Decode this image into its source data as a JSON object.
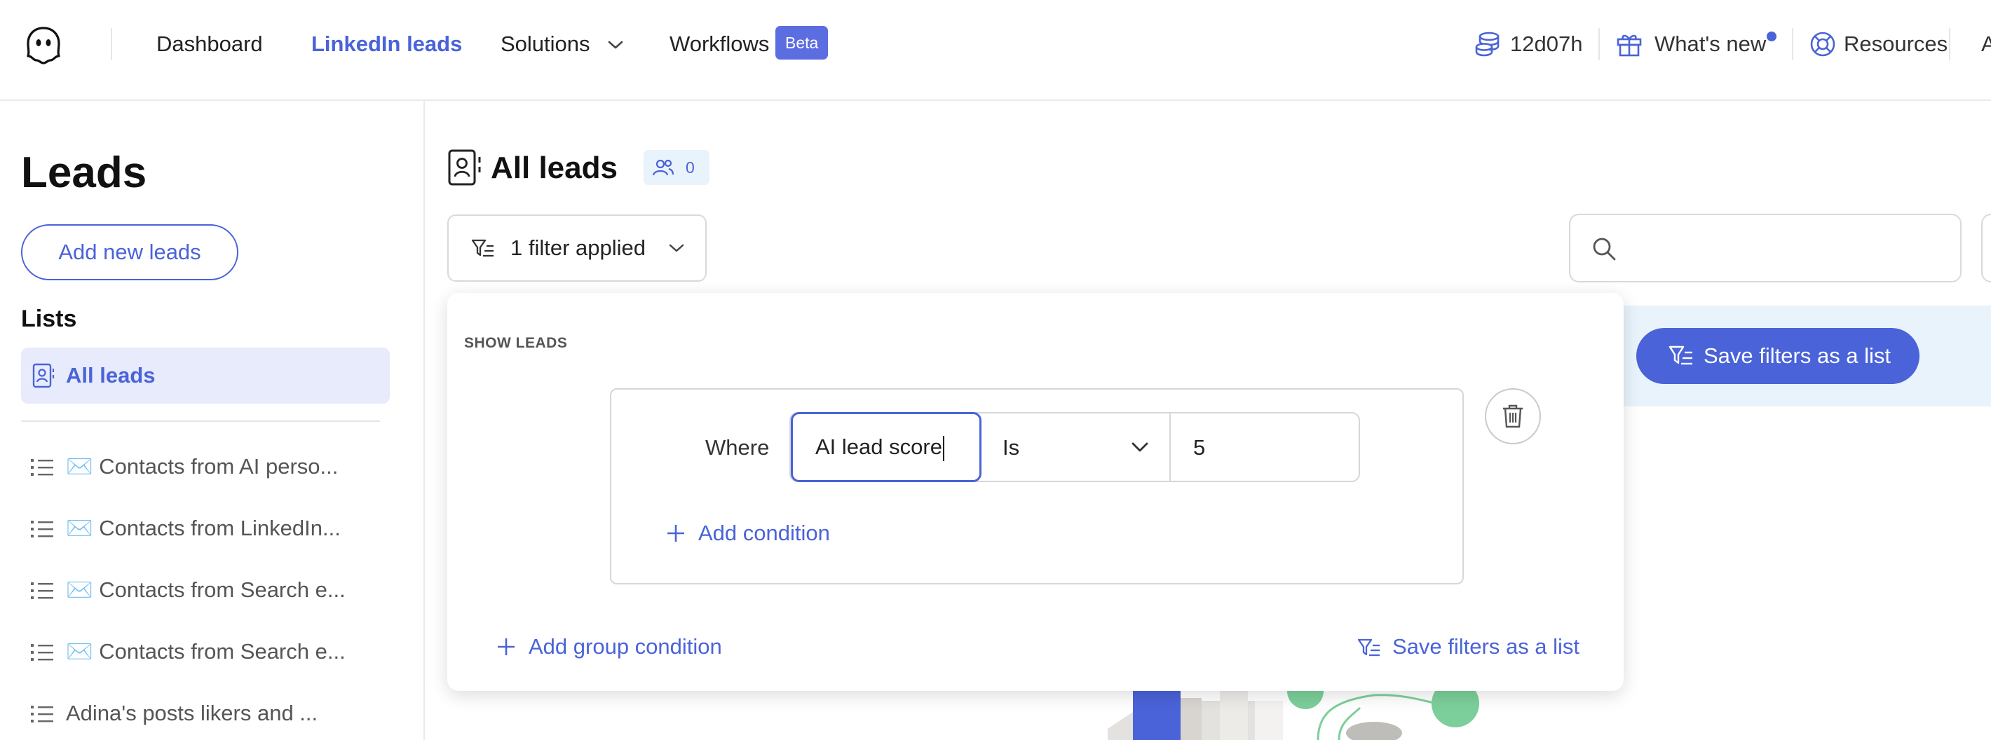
{
  "nav": {
    "items": [
      {
        "label": "Dashboard"
      },
      {
        "label": "LinkedIn leads"
      },
      {
        "label": "Solutions"
      },
      {
        "label": "Workflows"
      }
    ],
    "beta_badge": "Beta",
    "credits": "12d07h",
    "whats_new": "What's new",
    "resources": "Resources",
    "cut_off": "A"
  },
  "sidebar": {
    "title": "Leads",
    "add_button": "Add new leads",
    "lists_title": "Lists",
    "active_list": "All leads",
    "lists": [
      {
        "label": "✉️ Contacts from AI perso..."
      },
      {
        "label": "✉️ Contacts from LinkedIn..."
      },
      {
        "label": "✉️ Contacts from Search e..."
      },
      {
        "label": "✉️ Contacts from Search e..."
      },
      {
        "label": "Adina's posts likers and ..."
      }
    ]
  },
  "main": {
    "title": "All leads",
    "lead_count": "0",
    "filter_button": "1 filter applied",
    "search_placeholder": "",
    "save_filters_button": "Save filters as a list"
  },
  "filter_panel": {
    "heading": "SHOW LEADS",
    "where_label": "Where",
    "field_value": "AI lead score",
    "operator_value": "Is",
    "value": "5",
    "add_condition": "Add condition",
    "add_group_condition": "Add group condition",
    "save_filters_link": "Save filters as a list"
  },
  "colors": {
    "accent": "#4a63d8",
    "badge_bg": "#e9f3fb",
    "active_list_bg": "#e7ebfb"
  }
}
